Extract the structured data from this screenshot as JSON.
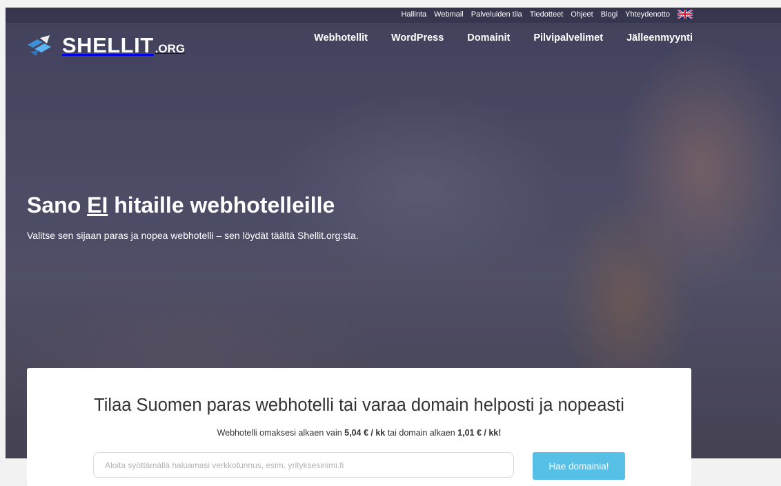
{
  "utility_nav": [
    "Hallinta",
    "Webmail",
    "Palveluiden tila",
    "Tiedotteet",
    "Ohjeet",
    "Blogi",
    "Yhteydenotto"
  ],
  "logo": {
    "main": "SHELLIT",
    "suffix": ".ORG"
  },
  "main_nav": [
    "Webhotellit",
    "WordPress",
    "Domainit",
    "Pilvipalvelimet",
    "Jälleenmyynti"
  ],
  "hero": {
    "title_before": "Sano ",
    "title_emphasis": "EI",
    "title_after": " hitaille webhotelleille",
    "subtitle": "Valitse sen sijaan paras ja nopea webhotelli – sen löydät täältä Shellit.org:sta."
  },
  "order_box": {
    "title": "Tilaa Suomen paras webhotelli tai varaa domain helposti ja nopeasti",
    "sub_part1": "Webhotelli omaksesi alkaen vain ",
    "sub_price1": "5,04 € / kk",
    "sub_part2": " tai domain alkaen ",
    "sub_price2": "1,01 € / kk!",
    "search_placeholder": "Aloita syöttämällä haluamasi verkkotunnus, esim. yrityksesinimi.fi",
    "search_value": "",
    "search_button": "Hae domainia!"
  },
  "colors": {
    "accent": "#57c0e6",
    "logo_icon": "#3d8fd6"
  },
  "icons": {
    "logo": "shellit-logo-icon",
    "language": "uk-flag-icon"
  }
}
